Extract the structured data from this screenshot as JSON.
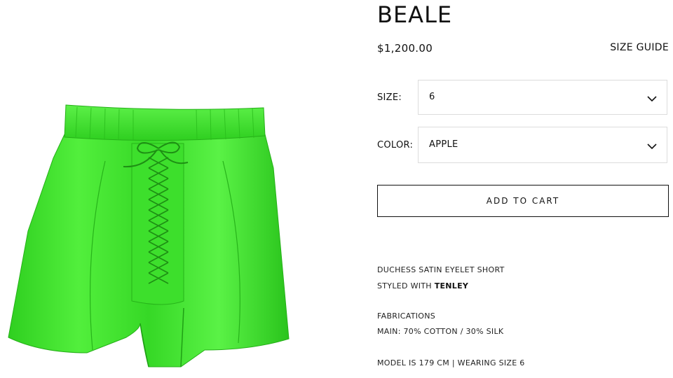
{
  "product": {
    "title": "BEALE",
    "price": "$1,200.00",
    "size_guide_label": "SIZE GUIDE",
    "image_icon": "green-satin-shorts-image"
  },
  "options": {
    "size": {
      "label": "SIZE:",
      "value": "6"
    },
    "color": {
      "label": "COLOR:",
      "value": "APPLE"
    }
  },
  "cart": {
    "button_label": "ADD TO CART"
  },
  "details": {
    "description": "DUCHESS SATIN EYELET SHORT",
    "styled_with_prefix": "STYLED WITH",
    "styled_with_item": "TENLEY",
    "fabrications_heading": "FABRICATIONS",
    "fabrication_main": "MAIN: 70% COTTON / 30% SILK",
    "model_info": "MODEL IS 179 CM | WEARING SIZE 6"
  },
  "colors": {
    "garment": "#3be22a",
    "garment_shadow": "#26b51a",
    "garment_highlight": "#7cf56a",
    "text": "#111111",
    "border": "#dcdcdc"
  }
}
